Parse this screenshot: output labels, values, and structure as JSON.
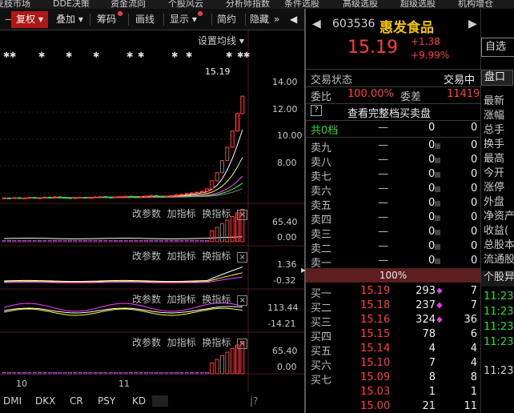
{
  "topnav": [
    "麦肢市场",
    "DDE决策",
    "资金流向",
    "个股风云",
    "分析师指数",
    "条件选股",
    "高级选股",
    "超级选股",
    "机构增仓"
  ],
  "toolbar": {
    "fuquan": "复权",
    "add_label": "叠加",
    "chouma": "筹码",
    "draw": "画线",
    "display": "显示",
    "simple": "简约",
    "hide": "隐藏",
    "more": "»"
  },
  "main_chart": {
    "settings": "设置均线",
    "price_marker": "15.19",
    "y_ticks": [
      "14.00",
      "12.00",
      "10.00",
      "8.00"
    ],
    "candles_close": [
      7.62,
      7.6,
      7.64,
      7.58,
      7.62,
      7.66,
      7.6,
      7.63,
      7.68,
      7.65,
      7.7,
      7.66,
      7.64,
      7.6,
      7.64,
      7.67,
      7.63,
      7.66,
      7.7,
      7.72,
      7.68,
      7.66,
      7.7,
      7.72,
      7.75,
      7.72,
      7.7,
      7.73,
      7.76,
      7.8,
      7.74,
      7.7,
      7.76,
      7.8,
      7.86,
      7.9,
      7.95,
      8.0,
      8.05,
      8.12,
      8.3,
      8.9,
      9.5,
      10.4,
      11.4,
      12.6,
      13.9,
      15.19
    ]
  },
  "sub_panels": [
    {
      "tools": [
        "改参数",
        "加指标",
        "换指标"
      ],
      "y_ticks": [
        "65.40",
        "0.00"
      ]
    },
    {
      "tools": [
        "改参数",
        "加指标",
        "换指标"
      ],
      "y_ticks": [
        "1.36",
        "-0.32"
      ]
    },
    {
      "tools": [
        "改参数",
        "加指标",
        "换指标"
      ],
      "y_ticks": [
        "113.44",
        "-14.21"
      ]
    },
    {
      "tools": [
        "改参数",
        "加指标",
        "换指标"
      ],
      "y_ticks": [
        "65.40",
        "0.00"
      ]
    }
  ],
  "bottom_tabs": [
    "DMI",
    "DKX",
    "CR",
    "PSY",
    "KD"
  ],
  "x_labels": [
    "10",
    "11"
  ],
  "stock": {
    "code": "603536",
    "name": "惠发食品",
    "price": "15.19",
    "change": "+1.38",
    "change_pct": "+9.99%",
    "self_select": "自选"
  },
  "trade_state": {
    "label": "交易状态",
    "value": "交易中"
  },
  "weibi": {
    "label": "委比",
    "value": "100.00%",
    "diff_label": "委差",
    "diff_value": "11419"
  },
  "full_book": {
    "help": "?",
    "label": "查看完整档买卖盘"
  },
  "total_level": {
    "label": "共0档",
    "dash": "—",
    "a": "0",
    "b": "0"
  },
  "asks": [
    {
      "label": "卖九",
      "price": "—",
      "vol": "0",
      "cnt": "0"
    },
    {
      "label": "卖八",
      "price": "—",
      "vol": "0",
      "cnt": "0"
    },
    {
      "label": "卖七",
      "price": "—",
      "vol": "0",
      "cnt": "0"
    },
    {
      "label": "卖六",
      "price": "—",
      "vol": "0",
      "cnt": "0"
    },
    {
      "label": "卖五",
      "price": "—",
      "vol": "0",
      "cnt": "0"
    },
    {
      "label": "卖四",
      "price": "—",
      "vol": "0",
      "cnt": "0"
    },
    {
      "label": "卖三",
      "price": "—",
      "vol": "0",
      "cnt": "0"
    },
    {
      "label": "卖二",
      "price": "—",
      "vol": "0",
      "cnt": "0"
    },
    {
      "label": "卖一",
      "price": "—",
      "vol": "0",
      "cnt": "0"
    }
  ],
  "ratio_bar": "100%",
  "bids": [
    {
      "label": "买一",
      "price": "15.19",
      "vol": "293",
      "cnt": "7",
      "mark": true
    },
    {
      "label": "买二",
      "price": "15.18",
      "vol": "237",
      "cnt": "7",
      "mark": true
    },
    {
      "label": "买三",
      "price": "15.16",
      "vol": "324",
      "cnt": "36",
      "mark": true
    },
    {
      "label": "买四",
      "price": "15.15",
      "vol": "78",
      "cnt": "6",
      "mark": false
    },
    {
      "label": "买五",
      "price": "15.14",
      "vol": "4",
      "cnt": "4",
      "mark": false
    },
    {
      "label": "买六",
      "price": "15.10",
      "vol": "7",
      "cnt": "4",
      "mark": false
    },
    {
      "label": "买七",
      "price": "15.09",
      "vol": "8",
      "cnt": "8",
      "mark": false
    },
    {
      "label": "",
      "price": "15.03",
      "vol": "1",
      "cnt": "1",
      "mark": false
    },
    {
      "label": "",
      "price": "15.00",
      "vol": "21",
      "cnt": "11",
      "mark": false
    }
  ],
  "far_panel": {
    "tab": "盘口",
    "items": [
      "最新",
      "涨幅",
      "总手",
      "换手",
      "最高",
      "今开",
      "涨停",
      "外盘",
      "净资产",
      "收益(",
      "总股本",
      "流通股"
    ],
    "tab2": "个股异",
    "times": [
      "11:23",
      "11:23",
      "11:23",
      "11:23",
      "11:23"
    ]
  },
  "colors": {
    "up": "#ff3c3c",
    "down": "#2fd62f",
    "accent": "#b01818"
  }
}
